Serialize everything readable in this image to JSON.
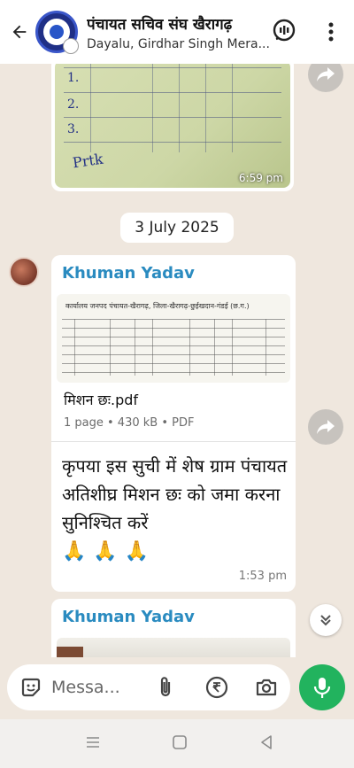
{
  "header": {
    "title": "पंचायत सचिव संघ खैरागढ़",
    "subtitle": "Dayalu, Girdhar Singh Mera..."
  },
  "messages": {
    "image_time": "6:59 pm",
    "date_separator": "3 July 2025",
    "doc_message": {
      "sender": "Khuman Yadav",
      "pdf_header": "कार्यालय जनपद पंचायत-खैरागढ़, जिला-खैरागढ़-छुईखदान-गंडई (छ.ग.)",
      "file_name": "मिशन छः.pdf",
      "file_meta": "1 page • 430 kB • PDF",
      "text": "कृपया इस सुची में शेष ग्राम पंचायत अतिशीघ्र मिशन छः को जमा करना सुनिश्चित करें",
      "emojis": "🙏🙏🙏",
      "time": "1:53 pm"
    },
    "next_message": {
      "sender": "Khuman Yadav"
    }
  },
  "composer": {
    "placeholder": "Messa..."
  },
  "icons": {
    "back": "arrow-left-icon",
    "header_action_1": "channel-icon",
    "header_action_2": "more-vert-icon",
    "forward": "forward-icon",
    "scroll_down": "double-chevron-down-icon",
    "sticker": "sticker-icon",
    "attach": "paperclip-icon",
    "payment": "rupee-icon",
    "camera": "camera-icon",
    "mic": "mic-icon"
  },
  "colors": {
    "accent_green": "#22b35e",
    "sender_blue": "#2a8bc0",
    "chat_background": "#efe7de"
  }
}
